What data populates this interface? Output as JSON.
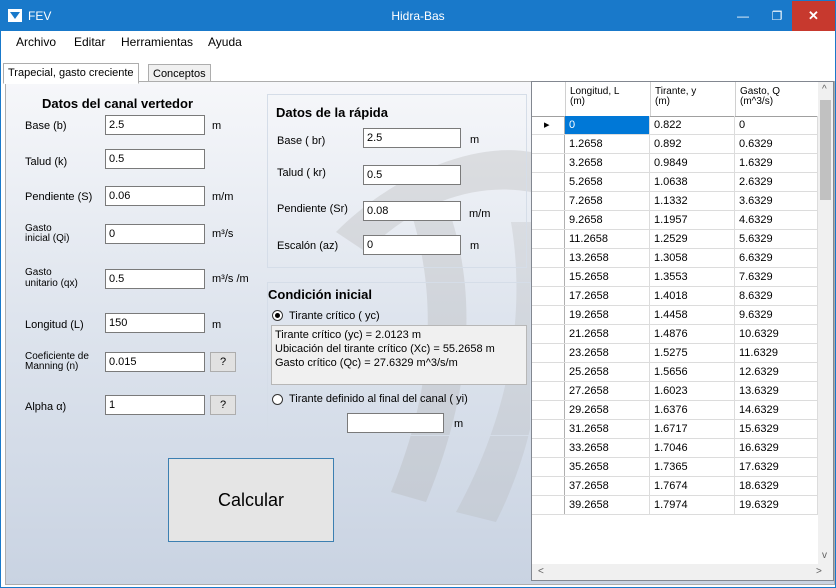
{
  "window": {
    "title_left": "FEV",
    "title_center": "Hidra-Bas",
    "min": "—",
    "max": "❐",
    "close": "✕"
  },
  "menu": [
    "Archivo",
    "Editar",
    "Herramientas",
    "Ayuda"
  ],
  "tabs": [
    "Trapecial, gasto creciente",
    "Conceptos"
  ],
  "canal": {
    "title": "Datos del canal vertedor",
    "base": {
      "label": "Base (b)",
      "value": "2.5",
      "unit": "m"
    },
    "talud": {
      "label": "Talud (k)",
      "value": "0.5"
    },
    "pendiente": {
      "label": "Pendiente (S)",
      "value": "0.06",
      "unit": "m/m"
    },
    "gasto_inicial": {
      "label1": "Gasto",
      "label2": "inicial (Qi)",
      "value": "0",
      "unit": "m³/s"
    },
    "gasto_unitario": {
      "label1": "Gasto",
      "label2": "unitario (qx)",
      "value": "0.5",
      "unit": "m³/s /m"
    },
    "longitud": {
      "label": "Longitud (L)",
      "value": "150",
      "unit": "m"
    },
    "manning": {
      "label1": "Coeficiente de",
      "label2": "Manning (n)",
      "value": "0.015",
      "btn": "?"
    },
    "alpha": {
      "label": "Alpha α)",
      "value": "1",
      "btn": "?"
    }
  },
  "rapida": {
    "title": "Datos de la rápida",
    "base": {
      "label": "Base ( br)",
      "value": "2.5",
      "unit": "m"
    },
    "talud": {
      "label": "Talud ( kr)",
      "value": "0.5"
    },
    "pendiente": {
      "label": "Pendiente (Sr)",
      "value": "0.08",
      "unit": "m/m"
    },
    "escalon": {
      "label": "Escalón (az)",
      "value": "0",
      "unit": "m"
    }
  },
  "condicion": {
    "title": "Condición inicial",
    "radio1": "Tirante crítico ( yc)",
    "info": [
      "Tirante crítico (yc) =  2.0123  m",
      "Ubicación del tirante crítico (Xc) =  55.2658  m",
      "Gasto crítico (Qc) =  27.6329  m^3/s/m"
    ],
    "radio2": "Tirante definido al final del canal ( yi)",
    "yi_value": "",
    "yi_unit": "m"
  },
  "calcular": "Calcular",
  "grid": {
    "headers": [
      [
        "Longitud, L",
        "(m)"
      ],
      [
        "Tirante, y",
        "(m)"
      ],
      [
        "Gasto, Q",
        "(m^3/s)"
      ]
    ],
    "current_row_marker": "▸",
    "rows": [
      [
        "0",
        "0.822",
        "0"
      ],
      [
        "1.2658",
        "0.892",
        "0.6329"
      ],
      [
        "3.2658",
        "0.9849",
        "1.6329"
      ],
      [
        "5.2658",
        "1.0638",
        "2.6329"
      ],
      [
        "7.2658",
        "1.1332",
        "3.6329"
      ],
      [
        "9.2658",
        "1.1957",
        "4.6329"
      ],
      [
        "11.2658",
        "1.2529",
        "5.6329"
      ],
      [
        "13.2658",
        "1.3058",
        "6.6329"
      ],
      [
        "15.2658",
        "1.3553",
        "7.6329"
      ],
      [
        "17.2658",
        "1.4018",
        "8.6329"
      ],
      [
        "19.2658",
        "1.4458",
        "9.6329"
      ],
      [
        "21.2658",
        "1.4876",
        "10.6329"
      ],
      [
        "23.2658",
        "1.5275",
        "11.6329"
      ],
      [
        "25.2658",
        "1.5656",
        "12.6329"
      ],
      [
        "27.2658",
        "1.6023",
        "13.6329"
      ],
      [
        "29.2658",
        "1.6376",
        "14.6329"
      ],
      [
        "31.2658",
        "1.6717",
        "15.6329"
      ],
      [
        "33.2658",
        "1.7046",
        "16.6329"
      ],
      [
        "35.2658",
        "1.7365",
        "17.6329"
      ],
      [
        "37.2658",
        "1.7674",
        "18.6329"
      ],
      [
        "39.2658",
        "1.7974",
        "19.6329"
      ]
    ],
    "scroll_up": "^",
    "scroll_down": "v",
    "scroll_left": "<",
    "scroll_right": ">"
  },
  "colors": {
    "titlebar": "#1979ca",
    "close": "#c7392e",
    "selection": "#0078d7"
  }
}
